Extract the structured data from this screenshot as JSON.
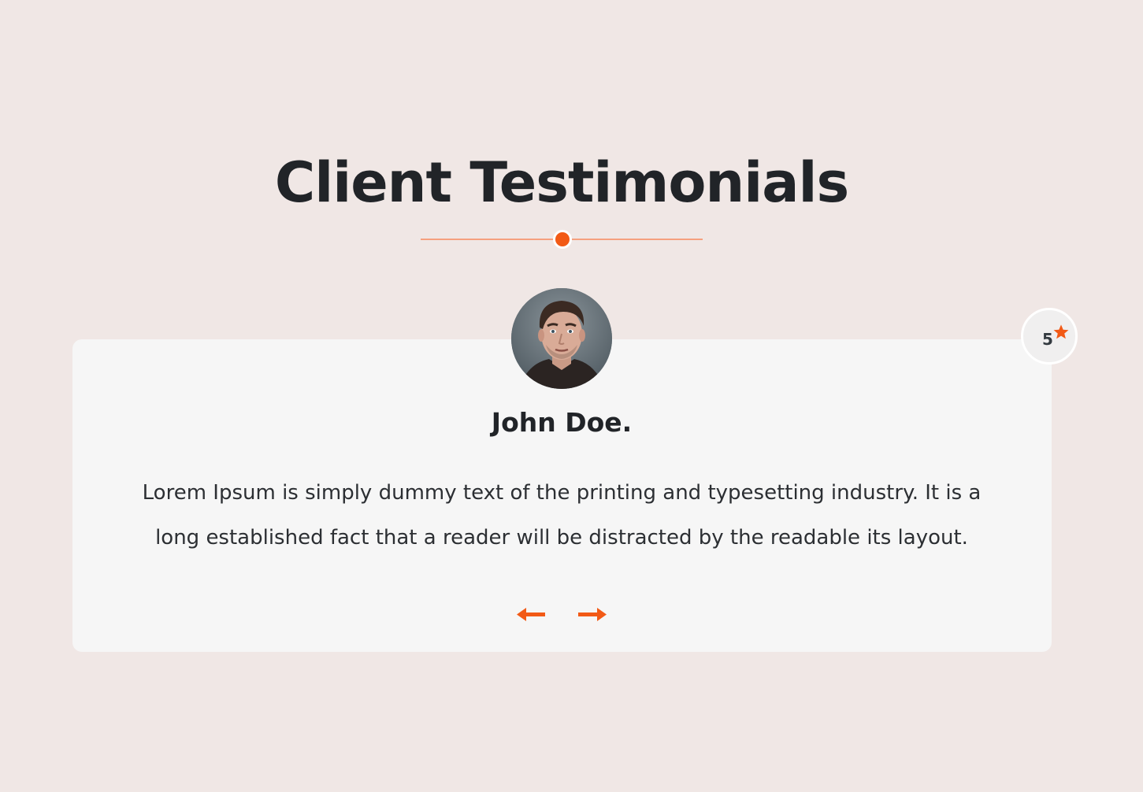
{
  "section": {
    "title": "Client Testimonials"
  },
  "testimonial": {
    "name": "John Doe.",
    "quote": "Lorem Ipsum is simply dummy text of the printing and typesetting industry. It is a long established fact that a reader will be distracted by the readable its layout.",
    "rating": "5",
    "avatar_icon": "person-photo"
  },
  "navigation": {
    "prev_icon": "arrow-left-icon",
    "next_icon": "arrow-right-icon"
  },
  "colors": {
    "background": "#f0e7e5",
    "card": "#f6f6f6",
    "accent": "#f25a16",
    "divider": "#f6a07f",
    "heading": "#212428"
  }
}
